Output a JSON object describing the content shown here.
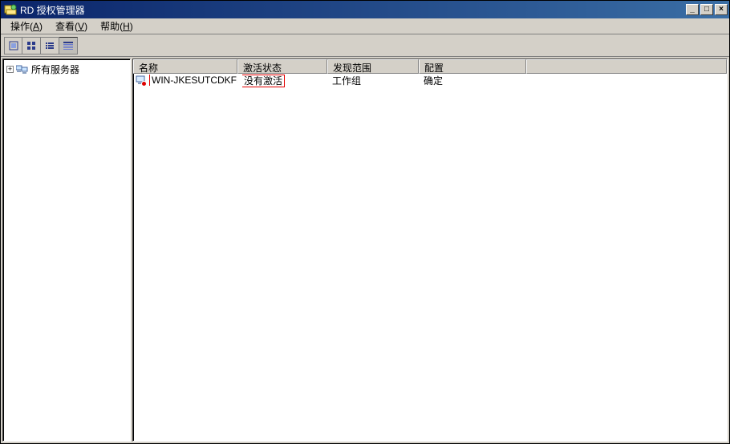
{
  "window": {
    "title": "RD 授权管理器"
  },
  "menubar": {
    "action": {
      "label": "操作",
      "mnemonic": "A"
    },
    "view": {
      "label": "查看",
      "mnemonic": "V"
    },
    "help": {
      "label": "帮助",
      "mnemonic": "H"
    }
  },
  "tree": {
    "root_label": "所有服务器"
  },
  "list": {
    "columns": {
      "name": "名称",
      "activation": "激活状态",
      "scope": "发现范围",
      "config": "配置"
    },
    "rows": [
      {
        "name": "WIN-JKESUTCDKFE",
        "activation": "没有激活",
        "scope": "工作组",
        "config": "确定"
      }
    ]
  }
}
